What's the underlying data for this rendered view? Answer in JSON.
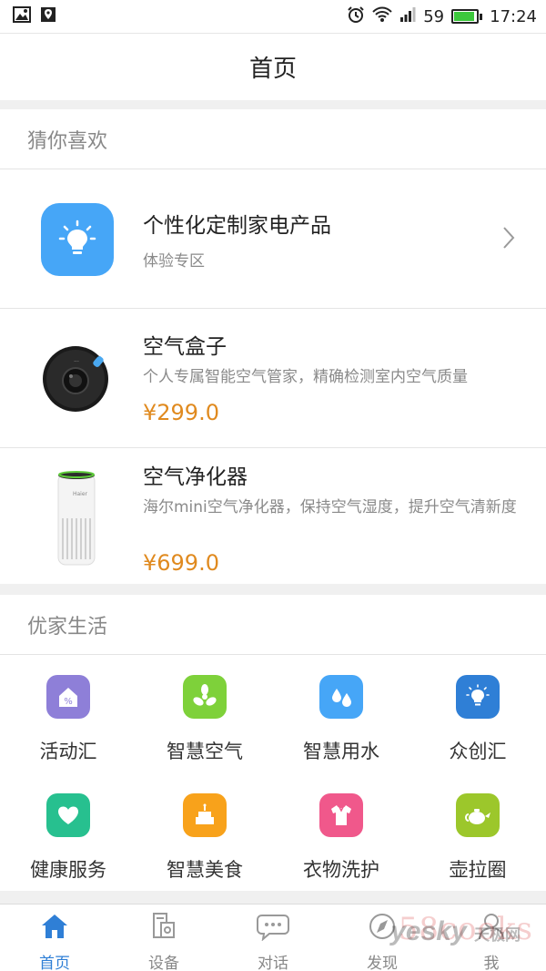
{
  "status_bar": {
    "signal_level": "59",
    "time": "17:24",
    "battery_fill": 0.9,
    "battery_color": "#3cc83c"
  },
  "header": {
    "title": "首页"
  },
  "recommend": {
    "title": "猜你喜欢",
    "items": [
      {
        "title": "个性化定制家电产品",
        "subtitle": "体验专区",
        "icon": "lightbulb-icon",
        "icon_color": "#46a6f7"
      },
      {
        "title": "空气盒子",
        "subtitle": "个人专属智能空气管家，精确检测室内空气质量",
        "price": "¥299.0"
      },
      {
        "title": "空气净化器",
        "subtitle": "海尔mini空气净化器，保持空气湿度，提升空气清新度",
        "price": "¥699.0"
      }
    ]
  },
  "life": {
    "title": "优家生活",
    "items": [
      {
        "label": "活动汇",
        "icon": "activity-house-icon",
        "color": "#8e7fd8"
      },
      {
        "label": "智慧空气",
        "icon": "fan-icon",
        "color": "#7ed13a"
      },
      {
        "label": "智慧用水",
        "icon": "water-drops-icon",
        "color": "#46a6f7"
      },
      {
        "label": "众创汇",
        "icon": "lightbulb-icon",
        "color": "#2f7fd6"
      },
      {
        "label": "健康服务",
        "icon": "heart-icon",
        "color": "#27c08f"
      },
      {
        "label": "智慧美食",
        "icon": "cake-icon",
        "color": "#f8a21b"
      },
      {
        "label": "衣物洗护",
        "icon": "shirt-icon",
        "color": "#f0588b"
      },
      {
        "label": "壶拉圈",
        "icon": "teapot-icon",
        "color": "#9cc72b"
      }
    ]
  },
  "tabs": [
    {
      "label": "首页",
      "icon": "home-icon",
      "active": true
    },
    {
      "label": "设备",
      "icon": "device-icon",
      "active": false
    },
    {
      "label": "对话",
      "icon": "chat-icon",
      "active": false
    },
    {
      "label": "发现",
      "icon": "compass-icon",
      "active": false
    },
    {
      "label": "我",
      "icon": "user-icon",
      "active": false
    }
  ],
  "watermark": {
    "site1": "58cooks",
    "site2": "yesky",
    "site2_sub": "天极网"
  },
  "colors": {
    "accent": "#2f7fd6",
    "price": "#e08a1f"
  }
}
